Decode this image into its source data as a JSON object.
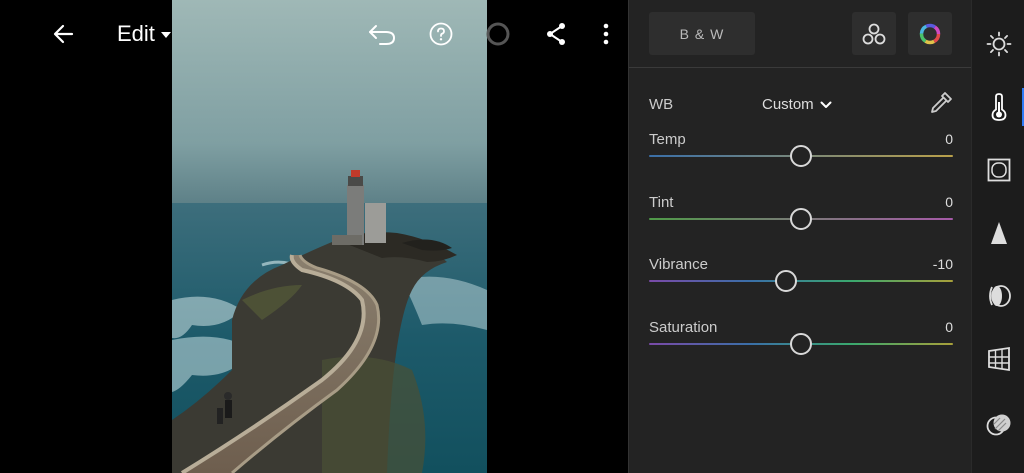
{
  "header": {
    "title": "Edit"
  },
  "panel": {
    "bw_label": "B & W",
    "wb": {
      "label": "WB",
      "value": "Custom"
    },
    "sliders": [
      {
        "label": "Temp",
        "value": "0",
        "position": 0.5,
        "gradient": [
          "#3a6fa8",
          "#b9a04a"
        ]
      },
      {
        "label": "Tint",
        "value": "0",
        "position": 0.5,
        "gradient": [
          "#4f9a48",
          "#a65aa8"
        ]
      },
      {
        "label": "Vibrance",
        "value": "-10",
        "position": 0.45,
        "gradient": [
          "#7a4aa8",
          "#3a6fa8",
          "#3aa86e",
          "#a8a03a"
        ]
      },
      {
        "label": "Saturation",
        "value": "0",
        "position": 0.5,
        "gradient": [
          "#7a4aa8",
          "#3a6fa8",
          "#3aa86e",
          "#a8a03a"
        ]
      }
    ]
  },
  "tools": [
    {
      "name": "light-icon",
      "active": false
    },
    {
      "name": "color-temperature-icon",
      "active": true
    },
    {
      "name": "effects-icon",
      "active": false
    },
    {
      "name": "detail-icon",
      "active": false
    },
    {
      "name": "optics-icon",
      "active": false
    },
    {
      "name": "geometry-icon",
      "active": false
    },
    {
      "name": "presets-icon",
      "active": false
    }
  ],
  "colors": {
    "accent": "#2f7bf6",
    "panel_bg": "#232323",
    "tool_bg": "#1c1c1c"
  }
}
